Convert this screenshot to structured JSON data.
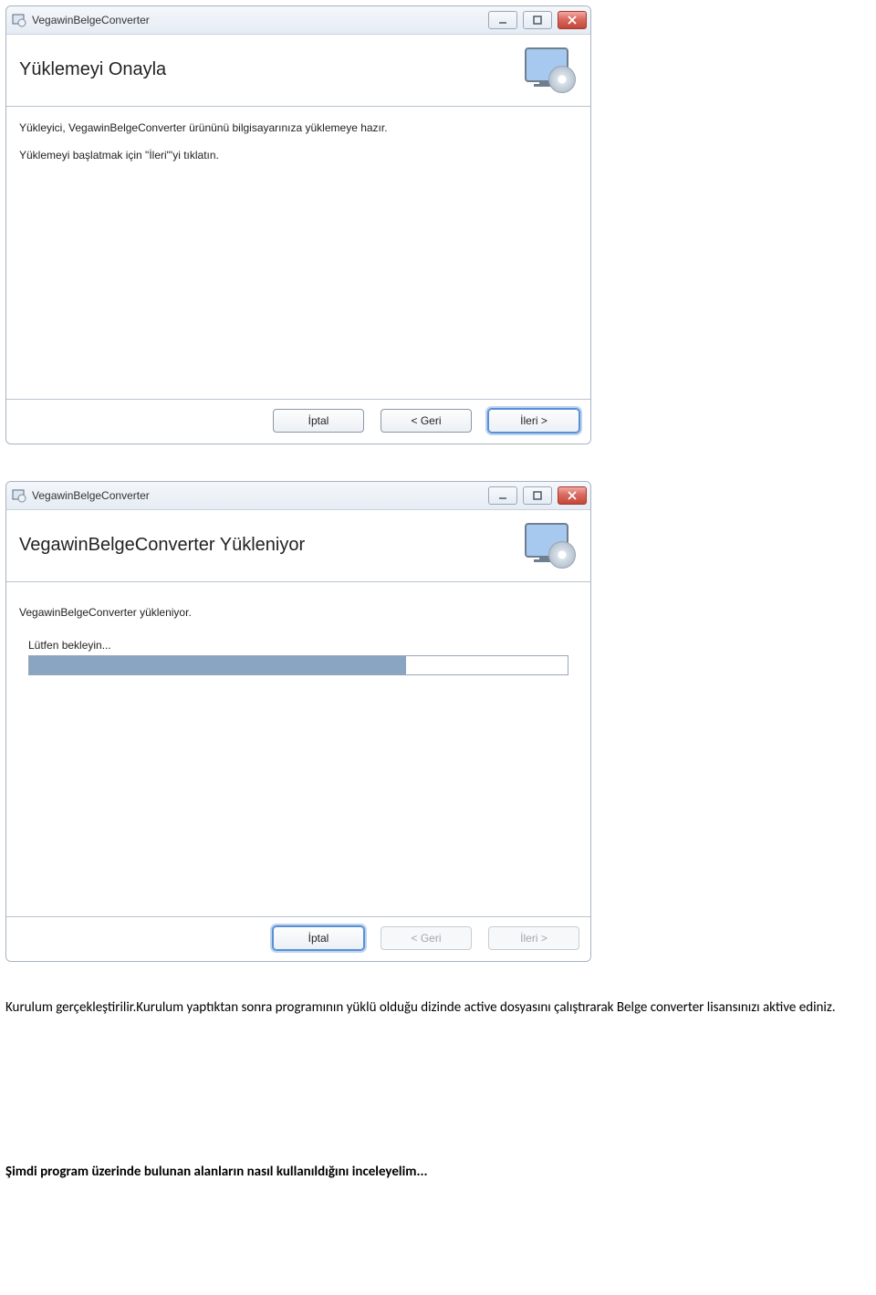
{
  "window1": {
    "title": "VegawinBelgeConverter",
    "headerTitle": "Yüklemeyi Onayla",
    "body1": "Yükleyici, VegawinBelgeConverter ürününü bilgisayarınıza yüklemeye hazır.",
    "body2": "Yüklemeyi başlatmak için \"İleri\"'yi tıklatın.",
    "btnCancel": "İptal",
    "btnBack": "< Geri",
    "btnNext": "İleri >"
  },
  "window2": {
    "title": "VegawinBelgeConverter",
    "headerTitle": "VegawinBelgeConverter Yükleniyor",
    "body1": "VegawinBelgeConverter yükleniyor.",
    "progressLabel": "Lütfen bekleyin...",
    "progressPercent": 70,
    "btnCancel": "İptal",
    "btnBack": "< Geri",
    "btnNext": "İleri >"
  },
  "doc": {
    "para1": "Kurulum gerçekleştirilir.Kurulum yaptıktan sonra programının yüklü olduğu dizinde active dosyasını çalıştırarak Belge converter lisansınızı aktive ediniz.",
    "para2": "Şimdi program üzerinde bulunan alanların nasıl kullanıldığını inceleyelim..."
  }
}
